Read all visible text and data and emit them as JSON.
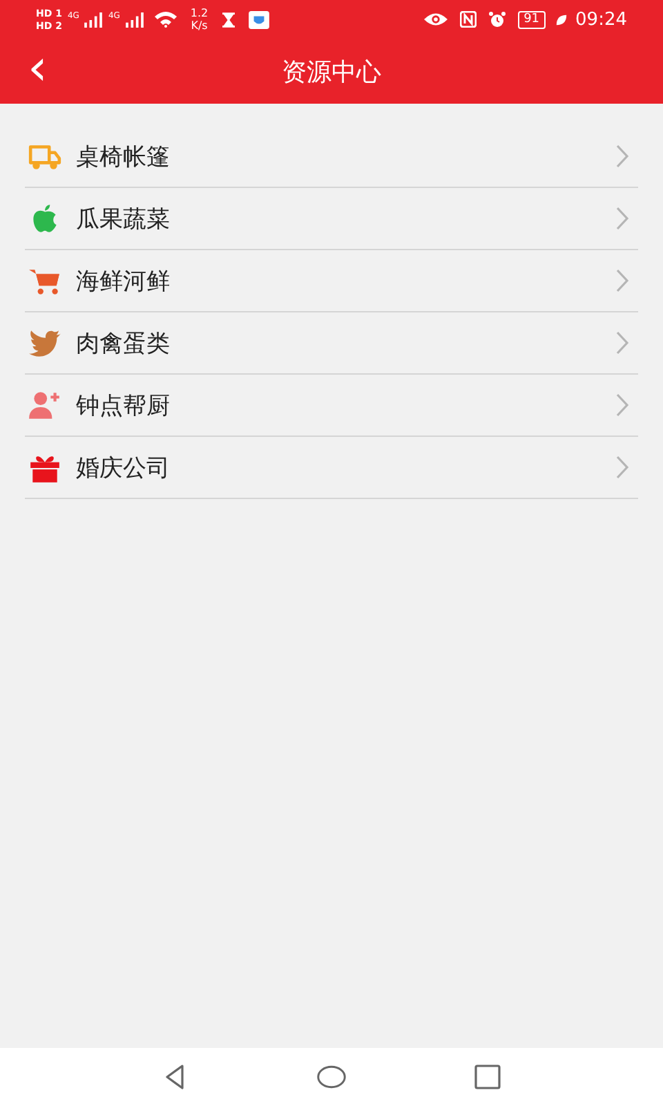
{
  "status_bar": {
    "sim_badges": [
      {
        "label": "HD",
        "slot": "1"
      },
      {
        "label": "HD",
        "slot": "2"
      }
    ],
    "networks": [
      "4G",
      "4G"
    ],
    "speed": "1.2",
    "speed_unit": "K/s",
    "battery": "91",
    "time": "09:24"
  },
  "header": {
    "back": "‹",
    "title": "资源中心"
  },
  "items": [
    {
      "label": "桌椅帐篷",
      "color": "#f5a623"
    },
    {
      "label": "瓜果蔬菜",
      "color": "#2db84d"
    },
    {
      "label": "海鲜河鲜",
      "color": "#e8582a"
    },
    {
      "label": "肉禽蛋类",
      "color": "#c8773a"
    },
    {
      "label": "钟点帮厨",
      "color": "#ee7072"
    },
    {
      "label": "婚庆公司",
      "color": "#e8141c"
    }
  ]
}
